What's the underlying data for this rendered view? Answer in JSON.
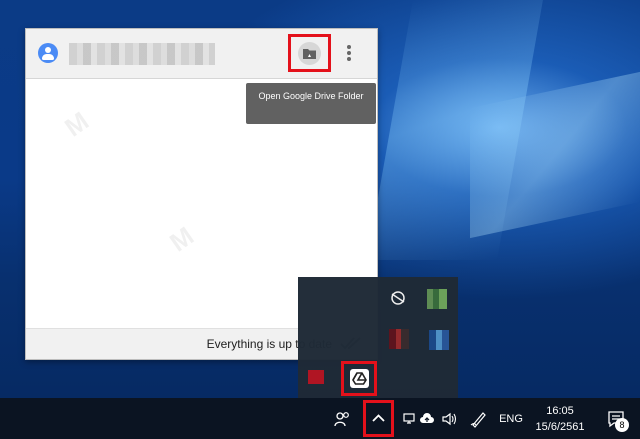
{
  "drive_popup": {
    "account_email": "",
    "tooltip": "Open Google Drive Folder",
    "status": "Everything is up to date",
    "icons": {
      "avatar": "account-circle-icon",
      "open_folder": "drive-folder-icon",
      "more": "more-vertical-icon",
      "status": "double-check-icon"
    }
  },
  "taskbar": {
    "language": "ENG",
    "time": "16:05",
    "date": "15/6/2561",
    "notification_count": "8",
    "icons": [
      "people-icon",
      "chevron-up-icon",
      "network-icon",
      "cloud-upload-icon",
      "volume-icon",
      "pen-icon",
      "action-center-icon"
    ]
  },
  "tray_overflow": {
    "icons": [
      "blurred-icon",
      "blurred-icon",
      "blurred-icon",
      "blurred-icon",
      "blurred-icon",
      "google-drive-icon"
    ]
  },
  "colors": {
    "highlight": "#e4111b",
    "tooltip_bg": "#616161",
    "popup_bg": "#ffffff",
    "taskbar_bg": "#0b1422"
  }
}
